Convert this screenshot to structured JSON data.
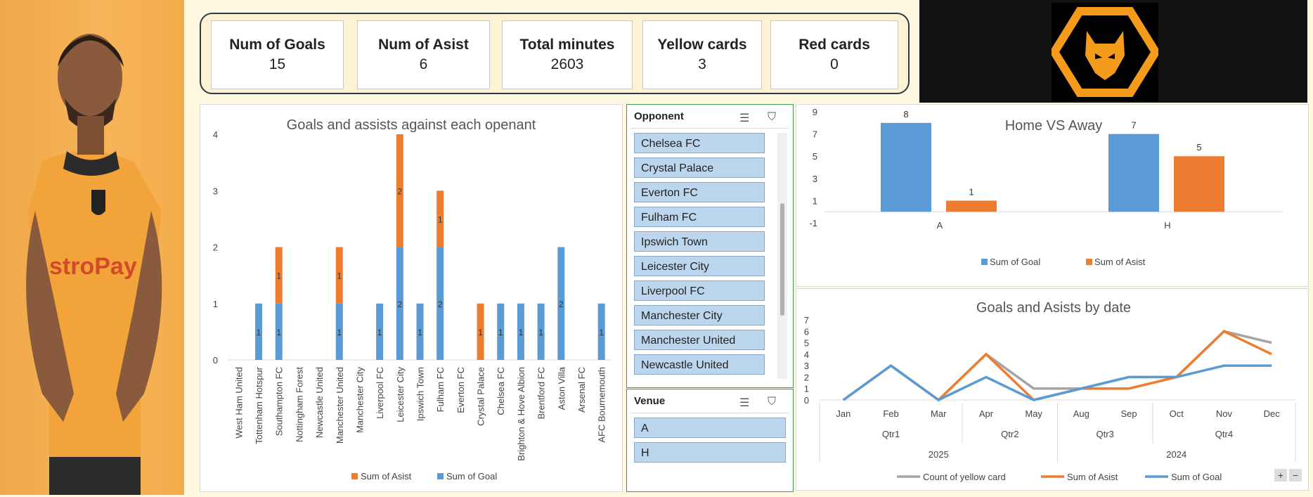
{
  "kpis": [
    {
      "label": "Num of Goals",
      "value": "15"
    },
    {
      "label": "Num of Asist",
      "value": "6"
    },
    {
      "label": "Total minutes",
      "value": "2603"
    },
    {
      "label": "Yellow cards",
      "value": "3"
    },
    {
      "label": "Red cards",
      "value": "0"
    }
  ],
  "slicers": {
    "opponent": {
      "title": "Opponent",
      "items": [
        "Chelsea FC",
        "Crystal Palace",
        "Everton FC",
        "Fulham FC",
        "Ipswich Town",
        "Leicester City",
        "Liverpool FC",
        "Manchester City",
        "Manchester United",
        "Newcastle United"
      ]
    },
    "venue": {
      "title": "Venue",
      "items": [
        "A",
        "H"
      ]
    }
  },
  "colors": {
    "goal": "#5b9bd5",
    "asist": "#ed7d31",
    "yellow": "#a5a5a5",
    "photo_bg": "#f4ad4d",
    "logo": "#f49b1c"
  },
  "chart_data": [
    {
      "type": "bar",
      "title": "Goals and assists against each openant",
      "categories": [
        "West Ham United",
        "Tottenham Hotspur",
        "Southampton FC",
        "Nottingham Forest",
        "Newcastle United",
        "Manchester United",
        "Manchester City",
        "Liverpool FC",
        "Leicester City",
        "Ipswich Town",
        "Fulham FC",
        "Everton FC",
        "Crystal Palace",
        "Chelsea FC",
        "Brighton & Hove Albion",
        "Brentford FC",
        "Aston Villa",
        "Arsenal FC",
        "AFC Bournemouth"
      ],
      "series": [
        {
          "name": "Sum of Goal",
          "values": [
            0,
            1,
            1,
            0,
            0,
            1,
            0,
            1,
            2,
            1,
            2,
            0,
            0,
            1,
            1,
            1,
            2,
            0,
            1
          ]
        },
        {
          "name": "Sum of Asist",
          "values": [
            0,
            0,
            1,
            0,
            0,
            1,
            0,
            0,
            2,
            0,
            1,
            0,
            1,
            0,
            0,
            0,
            0,
            0,
            0
          ]
        }
      ],
      "yticks": [
        "0",
        "1",
        "2",
        "3",
        "4"
      ],
      "ylim": [
        0,
        4
      ],
      "stacked": true,
      "legend": [
        "Sum of Asist",
        "Sum of Goal"
      ],
      "legend_position": "bottom"
    },
    {
      "type": "bar",
      "title": "Home VS Away",
      "categories": [
        "A",
        "H"
      ],
      "series": [
        {
          "name": "Sum of Goal",
          "values": [
            8,
            7
          ]
        },
        {
          "name": "Sum of Asist",
          "values": [
            1,
            5
          ]
        }
      ],
      "yticks": [
        "-1",
        "1",
        "3",
        "5",
        "7",
        "9"
      ],
      "ylim": [
        -1,
        9
      ],
      "legend": [
        "Sum of Goal",
        "Sum of Asist"
      ],
      "legend_position": "bottom"
    },
    {
      "type": "line",
      "title": "Goals and Asists by date",
      "categories": [
        "Jan",
        "Feb",
        "Mar",
        "Apr",
        "May",
        "Aug",
        "Sep",
        "Oct",
        "Nov",
        "Dec"
      ],
      "quarters": [
        {
          "label": "Qtr1",
          "span": 3
        },
        {
          "label": "Qtr2",
          "span": 2
        },
        {
          "label": "Qtr3",
          "span": 2
        },
        {
          "label": "Qtr4",
          "span": 3
        }
      ],
      "years": [
        {
          "label": "2025",
          "span": 5
        },
        {
          "label": "2024",
          "span": 5
        }
      ],
      "series": [
        {
          "name": "Count of yellow card",
          "values": [
            0,
            3,
            0,
            4,
            1,
            1,
            2,
            2,
            6,
            5
          ]
        },
        {
          "name": "Sum of Asist",
          "values": [
            0,
            3,
            0,
            4,
            0,
            1,
            1,
            2,
            6,
            4
          ]
        },
        {
          "name": "Sum of Goal",
          "values": [
            0,
            3,
            0,
            2,
            0,
            1,
            2,
            2,
            3,
            3
          ]
        }
      ],
      "yticks": [
        "0",
        "1",
        "2",
        "3",
        "4",
        "5",
        "6",
        "7"
      ],
      "ylim": [
        0,
        7
      ],
      "legend": [
        "Count of yellow card",
        "Sum of Asist",
        "Sum of Goal"
      ],
      "legend_position": "bottom"
    }
  ]
}
